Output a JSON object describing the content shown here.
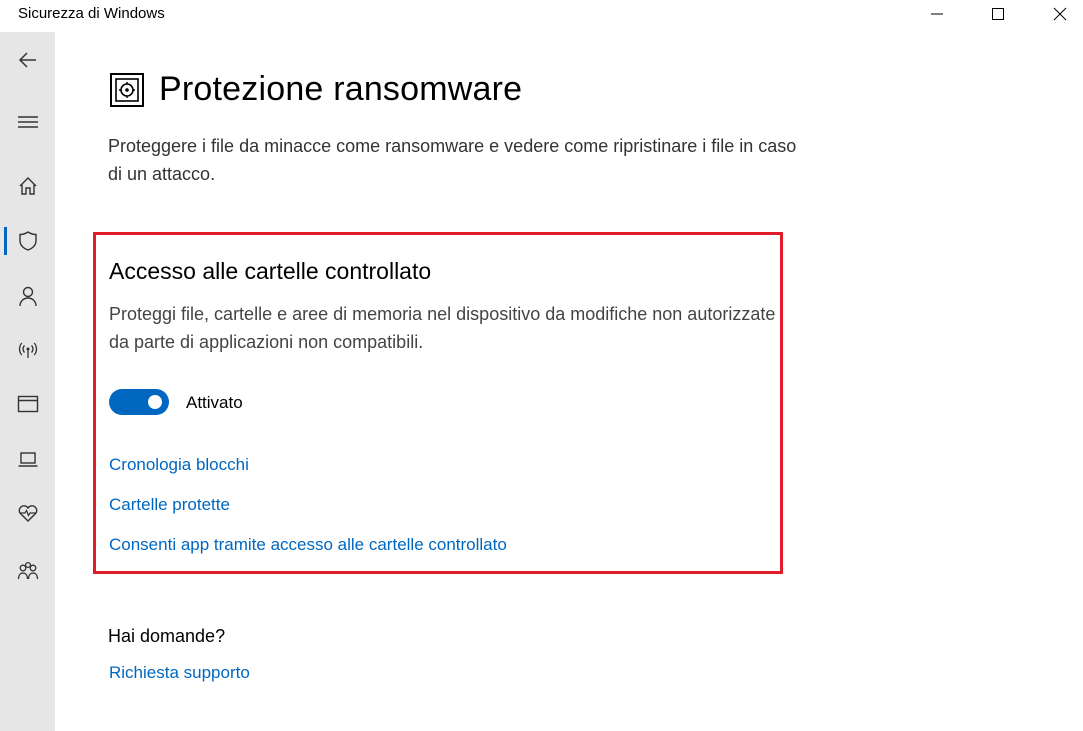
{
  "window": {
    "title": "Sicurezza di Windows",
    "controls": [
      "minimize-icon",
      "maximize-icon",
      "close-icon"
    ]
  },
  "sidebar": {
    "items": [
      {
        "icon": "back-arrow-icon"
      },
      {
        "icon": "hamburger-menu-icon"
      },
      {
        "icon": "home-icon"
      },
      {
        "icon": "shield-icon",
        "active": true
      },
      {
        "icon": "person-icon"
      },
      {
        "icon": "wireless-antenna-icon"
      },
      {
        "icon": "browser-window-icon"
      },
      {
        "icon": "laptop-icon"
      },
      {
        "icon": "heart-pulse-icon"
      },
      {
        "icon": "family-icon"
      }
    ],
    "accent": "#0067c0"
  },
  "main": {
    "title": "Protezione ransomware",
    "title_icon": "ransomware-vault-icon",
    "description": "Proteggere i file da minacce come ransomware e vedere come ripristinare i file in caso di un attacco.",
    "section": {
      "title": "Accesso alle cartelle controllato",
      "description": "Proteggi file, cartelle e aree di memoria nel dispositivo da modifiche non autorizzate da parte di applicazioni non compatibili.",
      "toggle": {
        "state": "on",
        "label": "Attivato"
      },
      "links": [
        "Cronologia blocchi",
        "Cartelle protette",
        "Consenti app tramite accesso alle cartelle controllato"
      ],
      "highlight_color": "#e01b2a"
    },
    "help": {
      "title": "Hai domande?",
      "link": "Richiesta supporto"
    }
  }
}
